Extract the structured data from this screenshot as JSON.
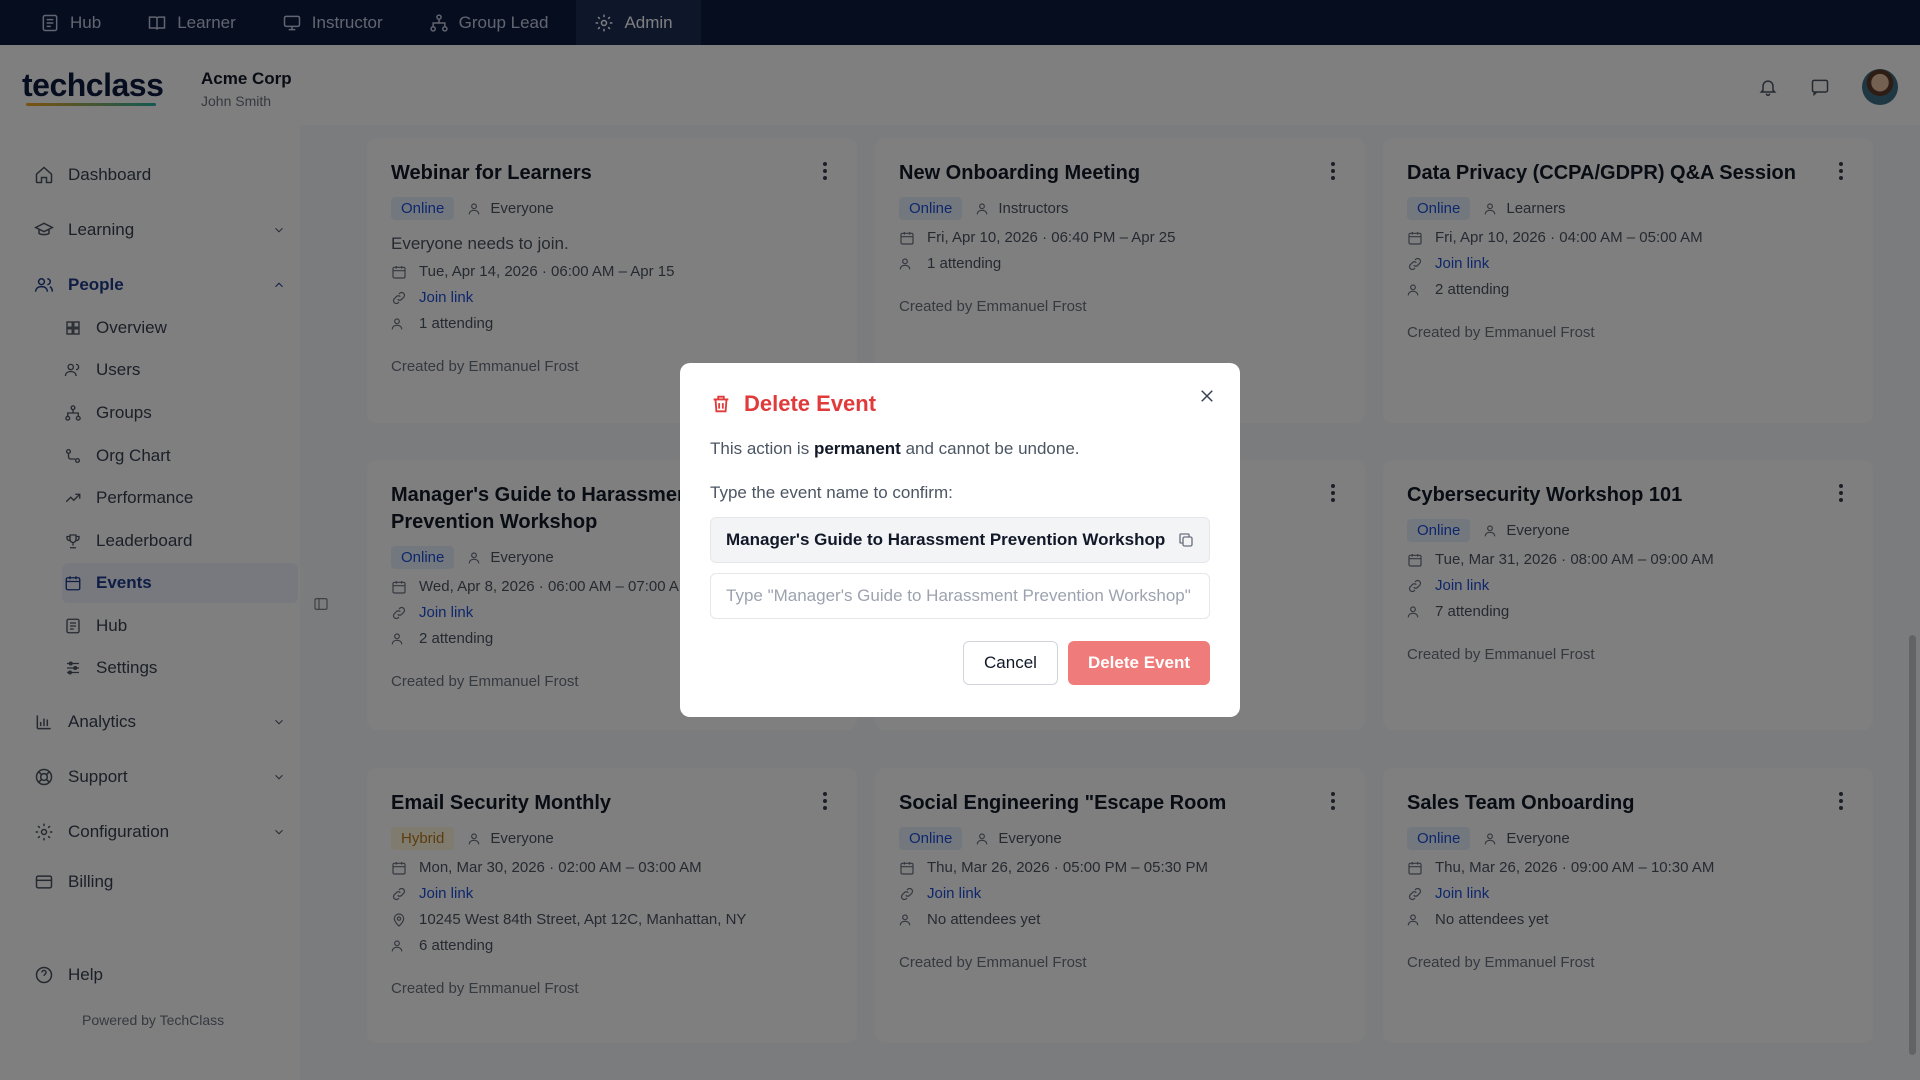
{
  "topnav": {
    "tabs": [
      {
        "label": "Hub"
      },
      {
        "label": "Learner"
      },
      {
        "label": "Instructor"
      },
      {
        "label": "Group Lead"
      },
      {
        "label": "Admin"
      }
    ]
  },
  "header": {
    "logo_text": "techclass",
    "org_name": "Acme Corp",
    "user_name": "John Smith"
  },
  "sidebar": {
    "items": [
      {
        "label": "Dashboard"
      },
      {
        "label": "Learning"
      },
      {
        "label": "People"
      },
      {
        "label": "Analytics"
      },
      {
        "label": "Support"
      },
      {
        "label": "Configuration"
      },
      {
        "label": "Billing"
      },
      {
        "label": "Help"
      }
    ],
    "people_sub": [
      {
        "label": "Overview"
      },
      {
        "label": "Users"
      },
      {
        "label": "Groups"
      },
      {
        "label": "Org Chart"
      },
      {
        "label": "Performance"
      },
      {
        "label": "Leaderboard"
      },
      {
        "label": "Events"
      },
      {
        "label": "Hub"
      },
      {
        "label": "Settings"
      }
    ],
    "powered_by": "Powered by TechClass"
  },
  "events": [
    {
      "title": "Webinar for Learners",
      "mode": "Online",
      "audience": "Everyone",
      "description": "Everyone needs to join.",
      "date": "Tue, Apr 14, 2026 · 06:00 AM – Apr 15",
      "link": "Join link",
      "attending": "1 attending",
      "created": "Created by Emmanuel Frost"
    },
    {
      "title": "New Onboarding Meeting",
      "mode": "Online",
      "audience": "Instructors",
      "date": "Fri, Apr 10, 2026 · 06:40 PM – Apr 25",
      "attending": "1 attending",
      "created": "Created by Emmanuel Frost"
    },
    {
      "title": "Data Privacy (CCPA/GDPR) Q&A Session",
      "mode": "Online",
      "audience": "Learners",
      "date": "Fri, Apr 10, 2026 · 04:00 AM – 05:00 AM",
      "link": "Join link",
      "attending": "2 attending",
      "created": "Created by Emmanuel Frost"
    },
    {
      "title": "Manager's Guide to Harassment Prevention Workshop",
      "mode": "Online",
      "audience": "Everyone",
      "date": "Wed, Apr 8, 2026 · 06:00 AM – 07:00 AM",
      "link": "Join link",
      "attending": "2 attending",
      "created": "Created by Emmanuel Frost"
    },
    {
      "title": "Cybersecurity Workshop 101",
      "mode": "Online",
      "audience": "Everyone",
      "date": "Tue, Mar 31, 2026 · 08:00 AM – 09:00 AM",
      "link": "Join link",
      "attending": "7 attending",
      "created": "Created by Emmanuel Frost"
    },
    {
      "title": "Email Security Monthly",
      "mode": "Hybrid",
      "audience": "Everyone",
      "date": "Mon, Mar 30, 2026 · 02:00 AM – 03:00 AM",
      "link": "Join link",
      "location": "10245 West 84th Street, Apt 12C, Manhattan, NY",
      "attending": "6 attending",
      "created": "Created by Emmanuel Frost"
    },
    {
      "title": "Social Engineering \"Escape Room",
      "mode": "Online",
      "audience": "Everyone",
      "date": "Thu, Mar 26, 2026 · 05:00 PM – 05:30 PM",
      "link": "Join link",
      "attending": "No attendees yet",
      "created": "Created by Emmanuel Frost"
    },
    {
      "title": "Sales Team Onboarding",
      "mode": "Online",
      "audience": "Everyone",
      "date": "Thu, Mar 26, 2026 · 09:00 AM – 10:30 AM",
      "link": "Join link",
      "attending": "No attendees yet",
      "created": "Created by Emmanuel Frost"
    }
  ],
  "modal": {
    "title": "Delete Event",
    "msg_prefix": "This action is ",
    "msg_bold": "permanent",
    "msg_suffix": " and cannot be undone.",
    "label": "Type the event name to confirm:",
    "event_name": "Manager's Guide to Harassment Prevention Workshop",
    "input_value": "",
    "input_placeholder": "Type \"Manager's Guide to Harassment Prevention Workshop\"",
    "cancel_label": "Cancel",
    "delete_label": "Delete Event"
  },
  "colors": {
    "topnav_bg": "#0d1b3e",
    "danger": "#e03a3a",
    "delete_button": "#f07b7b",
    "link": "#1d4ed8"
  }
}
